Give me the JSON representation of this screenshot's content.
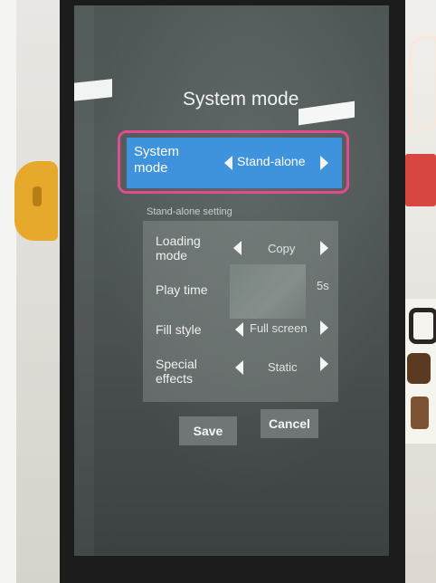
{
  "window": {
    "title": "System mode"
  },
  "system_mode": {
    "label": "System mode",
    "value": "Stand-alone",
    "selected": true
  },
  "standalone_setting": {
    "section_label": "Stand-alone setting",
    "rows": [
      {
        "label": "Loading mode",
        "value": "Copy",
        "has_arrows": true
      },
      {
        "label": "Play time",
        "value": "5s",
        "has_arrows": false
      },
      {
        "label": "Fill style",
        "value": "Full screen",
        "has_arrows": true
      },
      {
        "label": "Special effects",
        "value": "Static",
        "has_arrows": true
      }
    ]
  },
  "buttons": {
    "save": "Save",
    "cancel": "Cancel"
  },
  "icons": {
    "arrow_left": "triangle-left-icon",
    "arrow_right": "triangle-right-icon"
  },
  "colors": {
    "selected_row": "#3f93dc",
    "highlight_ring": "#e24b8d",
    "screen_bg": "#4e5555"
  }
}
